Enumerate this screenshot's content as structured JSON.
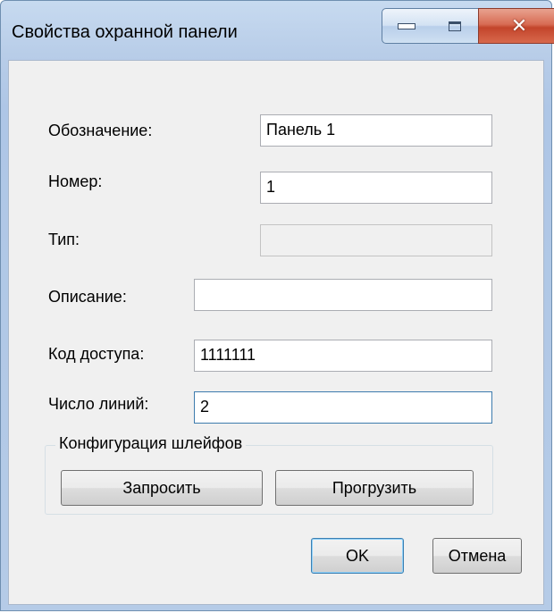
{
  "window": {
    "title": "Свойства охранной панели"
  },
  "form": {
    "designation_label": "Обозначение:",
    "designation_value": "Панель 1",
    "number_label": "Номер:",
    "number_value": "1",
    "type_label": "Тип:",
    "type_value": "",
    "description_label": "Описание:",
    "description_value": "",
    "access_code_label": "Код доступа:",
    "access_code_value": "1111111",
    "lines_label": "Число линий:",
    "lines_value": "2"
  },
  "loop_config": {
    "title": "Конфигурация шлейфов",
    "request_label": "Запросить",
    "upload_label": "Прогрузить"
  },
  "footer": {
    "ok_label": "OK",
    "cancel_label": "Отмена"
  },
  "icons": {
    "minimize": "minimize-icon",
    "maximize": "maximize-icon",
    "close": "close-icon"
  },
  "colors": {
    "close_button": "#c3452b",
    "focus_border": "#3d7bad"
  }
}
